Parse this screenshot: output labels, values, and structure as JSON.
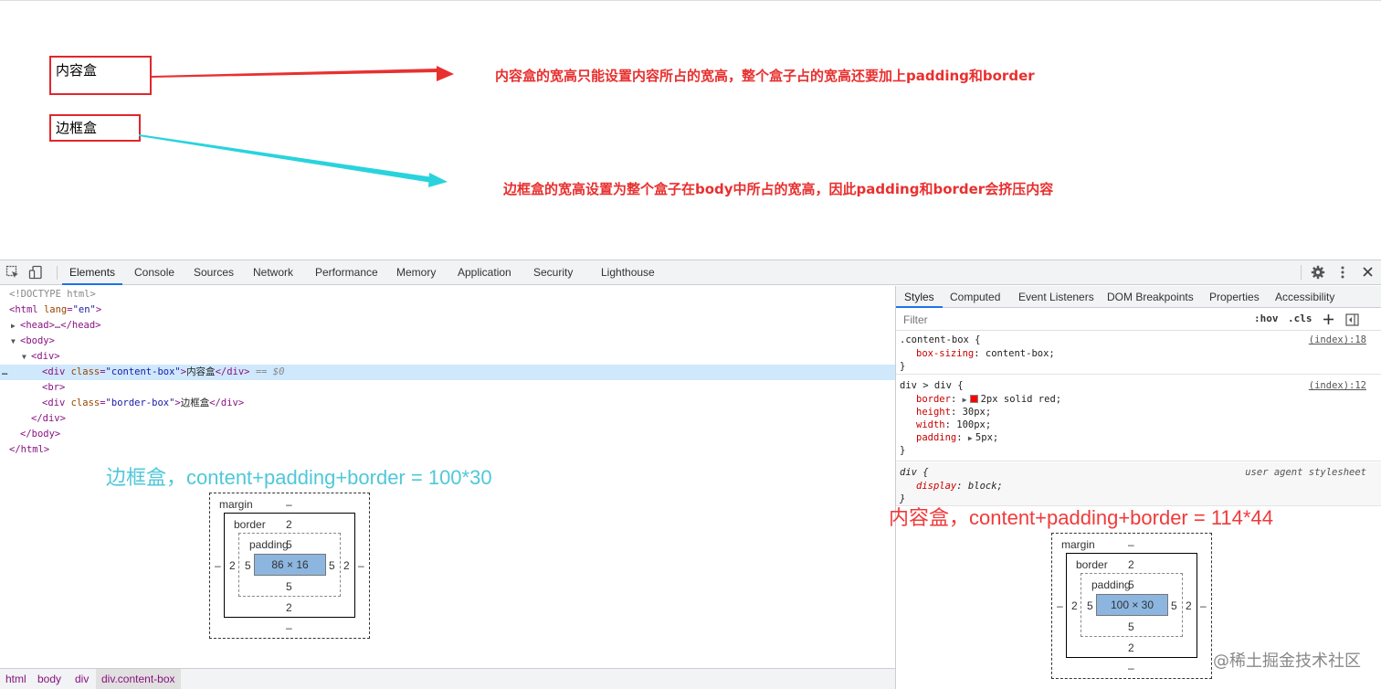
{
  "viewport": {
    "content_box_text": "内容盒",
    "border_box_text": "边框盒",
    "note_content": "内容盒的宽高只能设置内容所占的宽高，整个盒子占的宽高还要加上padding和border",
    "note_border": "边框盒的宽高设置为整个盒子在body中所占的宽高，因此padding和border会挤压内容",
    "colors": {
      "box_border": "#e0272c",
      "arrow_red": "#e8302f",
      "arrow_cyan": "#29d3dd",
      "note": "#e8302f"
    }
  },
  "toolbar": {
    "tabs": [
      "Elements",
      "Console",
      "Sources",
      "Network",
      "Performance",
      "Memory",
      "Application",
      "Security",
      "Lighthouse"
    ],
    "active_tab": "Elements"
  },
  "dom": {
    "doctype": "<!DOCTYPE html>",
    "html_open_tag": "<html ",
    "html_lang_attr": "lang",
    "html_lang_val": "\"en\"",
    "head": "<head>…</head>",
    "body_open": "<body>",
    "div_open": "<div>",
    "sel_prefix": "…",
    "sel_tag_open": "<div ",
    "sel_attr": "class",
    "sel_attr_val": "\"content-box\"",
    "sel_close_bracket": ">",
    "sel_text": "内容盒",
    "sel_tag_close": "</div>",
    "sel_marker": " == $0",
    "br": "<br>",
    "border_attr_val": "\"border-box\"",
    "border_text": "边框盒",
    "div_close": "</div>",
    "body_close": "</body>",
    "html_close": "</html>"
  },
  "styles_panel": {
    "tabs": [
      "Styles",
      "Computed",
      "Event Listeners",
      "DOM Breakpoints",
      "Properties",
      "Accessibility"
    ],
    "active_tab": "Styles",
    "filter_placeholder": "Filter",
    "hov": ":hov",
    "cls": ".cls",
    "rule1": {
      "selector": ".content-box {",
      "source": "(index):18",
      "prop": "box-sizing",
      "val": "content-box;"
    },
    "rule2": {
      "selector": "div > div {",
      "source": "(index):12",
      "props": [
        {
          "prop": "border",
          "val": "2px solid red;"
        },
        {
          "prop": "height",
          "val": "30px;"
        },
        {
          "prop": "width",
          "val": "100px;"
        },
        {
          "prop": "padding",
          "val": "5px;"
        }
      ]
    },
    "rule3": {
      "selector": "div {",
      "source": "user agent stylesheet",
      "prop": "display",
      "val": "block;"
    },
    "close_brace": "}"
  },
  "box_model_left": {
    "margin_label": "margin",
    "margin_top": "–",
    "margin_bottom": "–",
    "margin_left": "–",
    "margin_right": "–",
    "border_label": "border",
    "border_top": "2",
    "border_bottom": "2",
    "border_left": "2",
    "border_right": "2",
    "padding_label": "padding",
    "padding_top": "5",
    "padding_bottom": "5",
    "padding_left": "5",
    "padding_right": "5",
    "content": "86 × 16"
  },
  "box_model_right": {
    "margin_label": "margin",
    "margin_top": "–",
    "margin_bottom": "–",
    "margin_left": "–",
    "margin_right": "–",
    "border_label": "border",
    "border_top": "2",
    "border_bottom": "2",
    "border_left": "2",
    "border_right": "2",
    "padding_label": "padding",
    "padding_top": "5",
    "padding_bottom": "5",
    "padding_left": "5",
    "padding_right": "5",
    "content": "100 × 30"
  },
  "annotations": {
    "left": "边框盒，content+padding+border = 100*30",
    "right": "内容盒，content+padding+border = 114*44",
    "left_color": "#4fc8d8",
    "right_color": "#f03a3a"
  },
  "breadcrumbs": [
    "html",
    "body",
    "div",
    "div.content-box"
  ],
  "watermark": "@稀土掘金技术社区"
}
